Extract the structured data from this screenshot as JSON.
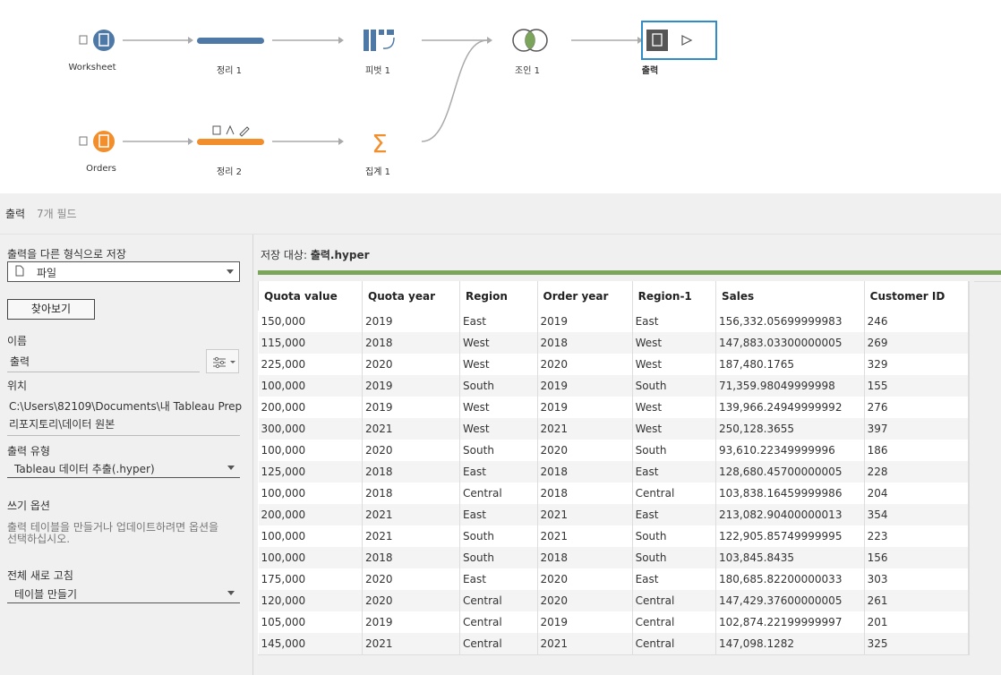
{
  "flow": {
    "nodes": {
      "worksheet": "Worksheet",
      "clean1": "정리 1",
      "pivot1": "피벗 1",
      "join1": "조인 1",
      "output": "출력",
      "orders": "Orders",
      "clean2": "정리 2",
      "aggregate1": "집계 1"
    }
  },
  "header": {
    "title": "출력",
    "field_count": "7개 필드"
  },
  "left": {
    "save_as_label": "출력을 다른 형식으로 저장",
    "save_as_value": "파일",
    "browse_label": "찾아보기",
    "name_label": "이름",
    "name_value": "출력",
    "location_label": "위치",
    "location_line1": "C:\\Users\\82109\\Documents\\내 Tableau Prep",
    "location_line2": "리포지토리\\데이터 원본",
    "output_type_label": "출력 유형",
    "output_type_value": "Tableau 데이터 추출(.hyper)",
    "write_options_label": "쓰기 옵션",
    "write_options_desc1": "출력 테이블을 만들거나 업데이트하려면 옵션을",
    "write_options_desc2": "선택하십시오.",
    "full_refresh_label": "전체 새로 고침",
    "full_refresh_value": "테이블 만들기"
  },
  "right": {
    "save_to_prefix": "저장 대상: ",
    "save_to_file": "출력.hyper"
  },
  "table": {
    "columns": [
      "Quota value",
      "Quota year",
      "Region",
      "Order year",
      "Region-1",
      "Sales",
      "Customer ID"
    ],
    "rows": [
      [
        "150,000",
        "2019",
        "East",
        "2019",
        "East",
        "156,332.05699999983",
        "246"
      ],
      [
        "115,000",
        "2018",
        "West",
        "2018",
        "West",
        "147,883.03300000005",
        "269"
      ],
      [
        "225,000",
        "2020",
        "West",
        "2020",
        "West",
        "187,480.1765",
        "329"
      ],
      [
        "100,000",
        "2019",
        "South",
        "2019",
        "South",
        "71,359.98049999998",
        "155"
      ],
      [
        "200,000",
        "2019",
        "West",
        "2019",
        "West",
        "139,966.24949999992",
        "276"
      ],
      [
        "300,000",
        "2021",
        "West",
        "2021",
        "West",
        "250,128.3655",
        "397"
      ],
      [
        "100,000",
        "2020",
        "South",
        "2020",
        "South",
        "93,610.22349999996",
        "186"
      ],
      [
        "125,000",
        "2018",
        "East",
        "2018",
        "East",
        "128,680.45700000005",
        "228"
      ],
      [
        "100,000",
        "2018",
        "Central",
        "2018",
        "Central",
        "103,838.16459999986",
        "204"
      ],
      [
        "200,000",
        "2021",
        "East",
        "2021",
        "East",
        "213,082.90400000013",
        "354"
      ],
      [
        "100,000",
        "2021",
        "South",
        "2021",
        "South",
        "122,905.85749999995",
        "223"
      ],
      [
        "100,000",
        "2018",
        "South",
        "2018",
        "South",
        "103,845.8435",
        "156"
      ],
      [
        "175,000",
        "2020",
        "East",
        "2020",
        "East",
        "180,685.82200000033",
        "303"
      ],
      [
        "120,000",
        "2020",
        "Central",
        "2020",
        "Central",
        "147,429.37600000005",
        "261"
      ],
      [
        "105,000",
        "2019",
        "Central",
        "2019",
        "Central",
        "102,874.22199999997",
        "201"
      ],
      [
        "145,000",
        "2021",
        "Central",
        "2021",
        "Central",
        "147,098.1282",
        "325"
      ]
    ]
  },
  "colors": {
    "blue": "#4e79a7",
    "orange": "#f28e2b",
    "green": "#7aa55a",
    "select_border": "#2e8cc9"
  }
}
